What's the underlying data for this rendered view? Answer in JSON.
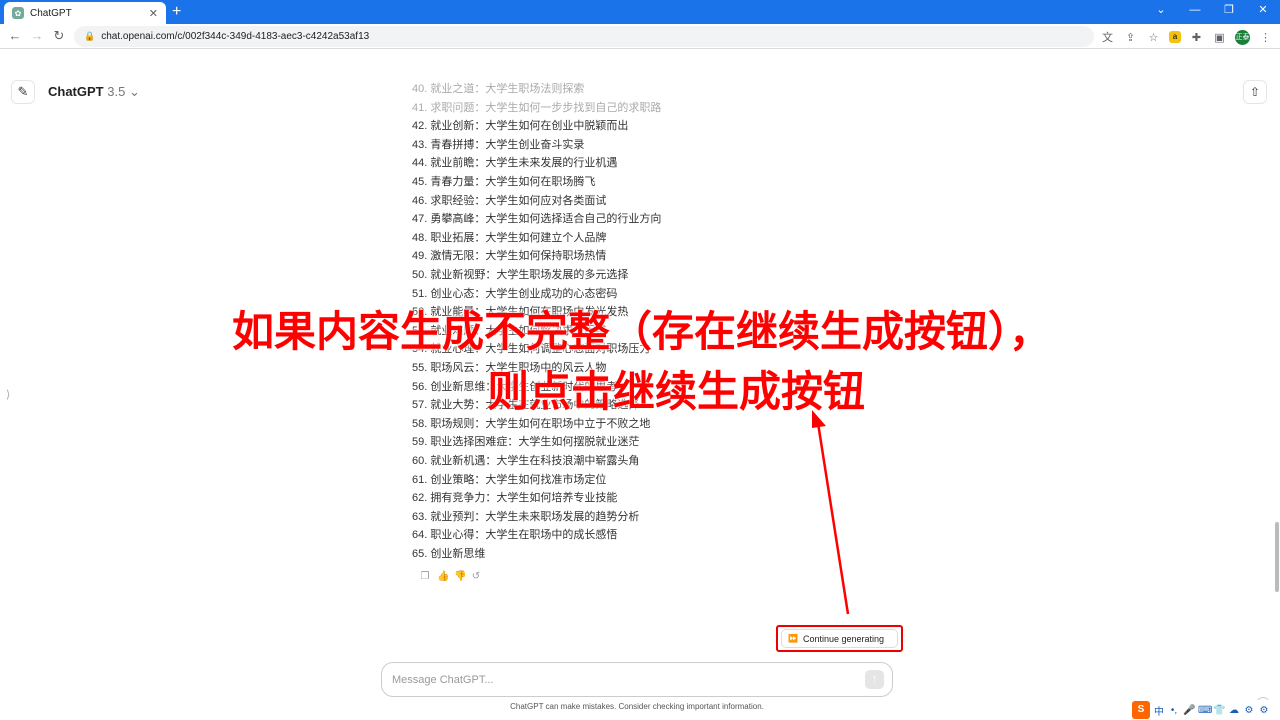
{
  "browser": {
    "tab_title": "ChatGPT",
    "tab_close": "✕",
    "new_tab": "+",
    "url": "chat.openai.com/c/002f344c-349d-4183-aec3-c4242a53af13",
    "window_controls": [
      "⌄",
      "—",
      "❐",
      "✕"
    ],
    "avatar_text": "正泰"
  },
  "header": {
    "model_name": "ChatGPT",
    "model_version": "3.5",
    "chevron": "⌄"
  },
  "messages": [
    {
      "text": "40. 就业之道：大学生职场法则探索",
      "faded": true
    },
    {
      "text": "41. 求职问题：大学生如何一步步找到自己的求职路",
      "faded": true
    },
    {
      "text": "42. 就业创新：大学生如何在创业中脱颖而出"
    },
    {
      "text": "43. 青春拼搏：大学生创业奋斗实录"
    },
    {
      "text": "44. 就业前瞻：大学生未来发展的行业机遇"
    },
    {
      "text": "45. 青春力量：大学生如何在职场腾飞"
    },
    {
      "text": "46. 求职经验：大学生如何应对各类面试"
    },
    {
      "text": "47. 勇攀高峰：大学生如何选择适合自己的行业方向"
    },
    {
      "text": "48. 职业拓展：大学生如何建立个人品牌"
    },
    {
      "text": "49. 激情无限：大学生如何保持职场热情"
    },
    {
      "text": "50. 就业新视野：大学生职场发展的多元选择"
    },
    {
      "text": "51. 创业心态：大学生创业成功的心态密码"
    },
    {
      "text": "52. 就业能量：大学生如何在职场中发光发热"
    },
    {
      "text": "53. 就业难题：大学生如何解决求职困惑"
    },
    {
      "text": "54. 就业心理：大学生如何调整心态面对职场压力"
    },
    {
      "text": "55. 职场风云：大学生职场中的风云人物"
    },
    {
      "text": "56. 创业新思维：大学生创业新时代的思考"
    },
    {
      "text": "57. 就业大势：大学生在就业市场中的策略选择"
    },
    {
      "text": "58. 职场规则：大学生如何在职场中立于不败之地"
    },
    {
      "text": "59. 职业选择困难症：大学生如何摆脱就业迷茫"
    },
    {
      "text": "60. 就业新机遇：大学生在科技浪潮中崭露头角"
    },
    {
      "text": "61. 创业策略：大学生如何找准市场定位"
    },
    {
      "text": "62. 拥有竞争力：大学生如何培养专业技能"
    },
    {
      "text": "63. 就业预判：大学生未来职场发展的趋势分析"
    },
    {
      "text": "64. 职业心得：大学生在职场中的成长感悟"
    },
    {
      "text": "65. 创业新思维"
    }
  ],
  "annotation": {
    "line1": "如果内容生成不完整（存在继续生成按钮），",
    "line2": "则点击继续生成按钮",
    "color": "#ff0000"
  },
  "continue_button": {
    "label": "Continue generating",
    "icon": "⏩"
  },
  "composer": {
    "placeholder": "Message ChatGPT...",
    "send_icon": "↑"
  },
  "disclaimer": "ChatGPT can make mistakes. Consider checking important information.",
  "help": "?",
  "ime": [
    "S",
    "中",
    "•,",
    "🎤",
    "⌨",
    "👕",
    "☁",
    "⚙",
    "⚙"
  ]
}
